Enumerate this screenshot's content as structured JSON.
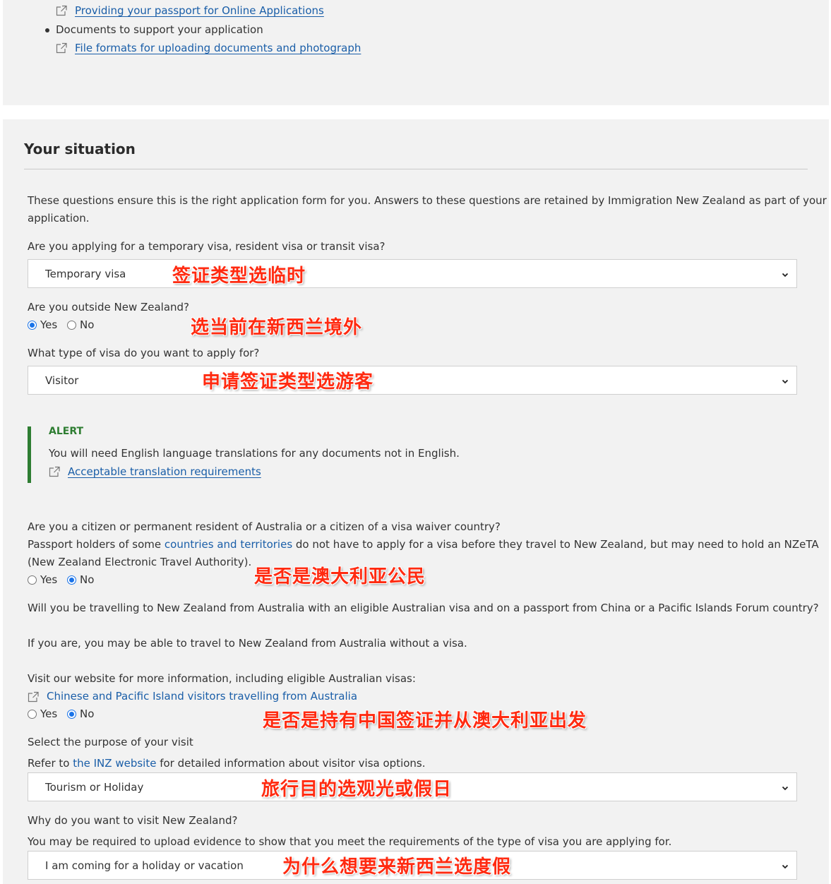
{
  "docs": {
    "passport_link": "Providing your passport for Online Applications",
    "bullet_text": "Documents to support your application",
    "file_formats_link": "File formats for uploading documents and photograph"
  },
  "situation": {
    "heading": "Your situation",
    "intro": "These questions ensure this is the right application form for you. Answers to these questions are retained by Immigration New Zealand as part of your",
    "intro_line2": "application.",
    "q_visa_kind": "Are you applying for a temporary visa, resident visa or transit visa?",
    "visa_kind_value": "Temporary visa",
    "q_outside": "Are you outside New Zealand?",
    "outside": {
      "yes": "Yes",
      "no": "No",
      "selected": "Yes"
    },
    "q_visa_type": "What type of visa do you want to apply for?",
    "visa_type_value": "Visitor",
    "alert": {
      "title": "ALERT",
      "text": "You will need English language translations for any documents not in English.",
      "link": "Acceptable translation requirements"
    },
    "q_citizen": "Are you a citizen or permanent resident of Australia or a citizen of a visa waiver country?",
    "citizen_text_pre": "Passport holders of some ",
    "citizen_link": "countries and territories",
    "citizen_text_post": " do not have to apply for a visa before they travel to New Zealand, but may need to hold an NZeTA",
    "citizen_text_line2": "(New Zealand Electronic Travel Authority).",
    "citizen": {
      "yes": "Yes",
      "no": "No",
      "selected": "No"
    },
    "q_travel_au": "Will you be travelling to New Zealand from Australia with an eligible Australian visa and on a passport from China or a Pacific Islands Forum country?",
    "travel_au_text": "If you are, you may be able to travel to New Zealand from Australia without a visa.",
    "travel_au_visit": "Visit our website for more information, including eligible Australian visas:",
    "travel_au_link": "Chinese and Pacific Island visitors travelling from Australia",
    "travel_au": {
      "yes": "Yes",
      "no": "No",
      "selected": "No"
    },
    "q_purpose": "Select the purpose of your visit",
    "purpose_refer_pre": "Refer to ",
    "purpose_refer_link": "the INZ website",
    "purpose_refer_post": " for detailed information about visitor visa options.",
    "purpose_value": "Tourism or Holiday",
    "q_why": "Why do you want to visit New Zealand?",
    "why_text": "You may be required to upload evidence to show that you meet the requirements of the type of visa you are applying for.",
    "why_value": "I am coming for a holiday or vacation"
  },
  "annotations": {
    "a1": "签证类型选临时",
    "a2": "选当前在新西兰境外",
    "a3": "申请签证类型选游客",
    "a4": "是否是澳大利亚公民",
    "a5": "是否是持有中国签证并从澳大利亚出发",
    "a6": "旅行目的选观光或假日",
    "a7": "为什么想要来新西兰选度假"
  },
  "colors": {
    "panel_bg": "#f2f2f2",
    "link": "#1a5ea8",
    "alert_green": "#2e7d32",
    "annotation_red": "#ff2a10",
    "radio_checked": "#1a73e8"
  },
  "icons": [
    "external-link-icon",
    "chevron-down-icon"
  ]
}
